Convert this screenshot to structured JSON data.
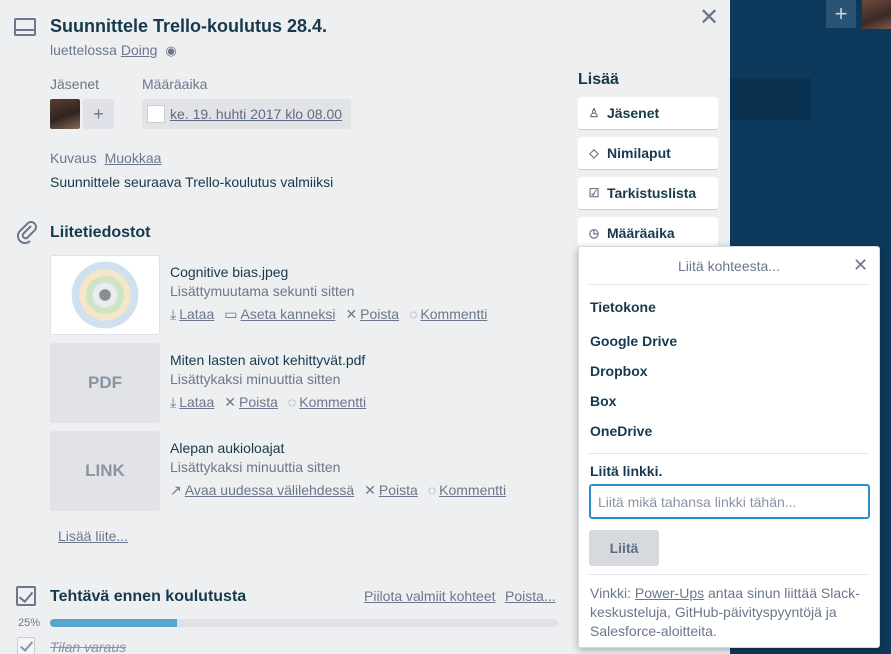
{
  "card": {
    "title": "Suunnittele Trello-koulutus 28.4.",
    "list_prefix": "luettelossa",
    "list_name": "Doing",
    "eye_icon": "◉",
    "close_icon": "✕",
    "members_label": "Jäsenet",
    "add_member": "+",
    "due_label": "Määräaika",
    "due_value": "ke. 19. huhti 2017 klo 08.00",
    "description_label": "Kuvaus",
    "description_edit": "Muokkaa",
    "description_text": "Suunnittele seuraava Trello-koulutus valmiiksi"
  },
  "attachments": {
    "title": "Liitetiedostot",
    "add_link": "Lisää liite...",
    "items": [
      {
        "name": "Cognitive bias.jpeg",
        "time": "Lisättymuutama sekunti sitten",
        "actions": [
          {
            "icon": "⤓",
            "label": "Lataa"
          },
          {
            "icon": "▭",
            "label": "Aseta kanneksi"
          },
          {
            "icon": "✕",
            "label": "Poista"
          },
          {
            "icon": "◌",
            "label": "Kommentti"
          }
        ]
      },
      {
        "thumb": "PDF",
        "name": "Miten lasten aivot kehittyvät.pdf",
        "time": "Lisättykaksi minuuttia sitten",
        "actions": [
          {
            "icon": "⤓",
            "label": "Lataa"
          },
          {
            "icon": "✕",
            "label": "Poista"
          },
          {
            "icon": "◌",
            "label": "Kommentti"
          }
        ]
      },
      {
        "thumb": "LINK",
        "name": "Alepan aukioloajat",
        "time": "Lisättykaksi minuuttia sitten",
        "actions": [
          {
            "icon": "↗",
            "label": "Avaa uudessa välilehdessä"
          },
          {
            "icon": "✕",
            "label": "Poista"
          },
          {
            "icon": "◌",
            "label": "Kommentti"
          }
        ]
      }
    ]
  },
  "checklist": {
    "title": "Tehtävä ennen koulutusta",
    "hide_done": "Piilota valmiit kohteet",
    "delete": "Poista...",
    "progress_label": "25%",
    "progress": 0.25,
    "items": [
      {
        "text": "Tilan varaus",
        "done": true
      }
    ]
  },
  "sidebar": {
    "heading": "Lisää",
    "buttons": [
      {
        "icon": "♙",
        "label": "Jäsenet"
      },
      {
        "icon": "◇",
        "label": "Nimilaput"
      },
      {
        "icon": "☑",
        "label": "Tarkistuslista"
      },
      {
        "icon": "◷",
        "label": "Määräaika"
      }
    ]
  },
  "popover": {
    "title": "Liitä kohteesta...",
    "close_icon": "✕",
    "options": [
      "Tietokone",
      "Google Drive",
      "Dropbox",
      "Box",
      "OneDrive"
    ],
    "link_label": "Liitä linkki.",
    "input_placeholder": "Liitä mikä tahansa linkki tähän...",
    "input_value": "",
    "attach_button": "Liitä",
    "tip_prefix": "Vinkki: ",
    "tip_link": "Power-Ups",
    "tip_suffix": " antaa sinun liittää Slack-keskusteluja, GitHub-päivityspyyntöjä ja Salesforce-aloitteita."
  },
  "board": {
    "add_icon": "+"
  }
}
